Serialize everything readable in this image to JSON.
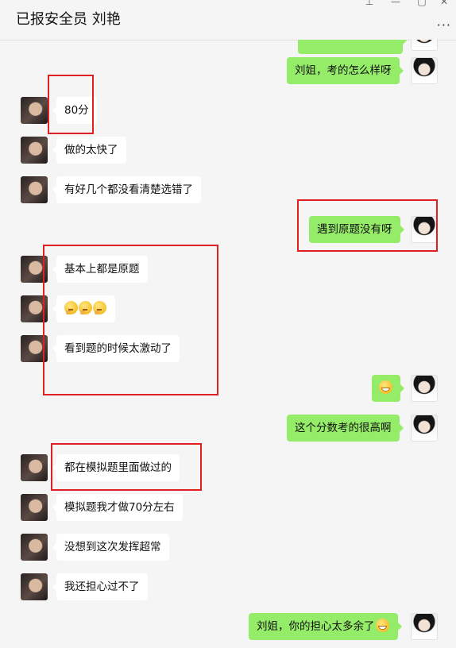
{
  "header": {
    "title": "已报安全员    刘艳",
    "pin_icon": "pin-icon",
    "minimize_icon": "minimize-icon",
    "maximize_icon": "maximize-icon",
    "close_icon": "close-icon",
    "more_label": "···"
  },
  "messages": [
    {
      "side": "right",
      "text": ""
    },
    {
      "side": "right",
      "text": "刘姐，考的怎么样呀"
    },
    {
      "side": "left",
      "text": "80分"
    },
    {
      "side": "left",
      "text": "做的太快了"
    },
    {
      "side": "left",
      "text": "有好几个都没看清楚选错了"
    },
    {
      "side": "right",
      "text": "遇到原题没有呀"
    },
    {
      "side": "left",
      "text": "基本上都是原题"
    },
    {
      "side": "left",
      "text": "",
      "emojis": [
        "thinking-emoji",
        "thinking-emoji",
        "thinking-emoji"
      ]
    },
    {
      "side": "left",
      "text": "看到题的时候太激动了"
    },
    {
      "side": "right",
      "text": "",
      "emojis": [
        "grin-emoji"
      ]
    },
    {
      "side": "right",
      "text": "这个分数考的很高啊"
    },
    {
      "side": "left",
      "text": "都在模拟题里面做过的"
    },
    {
      "side": "left",
      "text": "模拟题我才做70分左右"
    },
    {
      "side": "left",
      "text": "没想到这次发挥超常"
    },
    {
      "side": "left",
      "text": "我还担心过不了"
    },
    {
      "side": "right",
      "text": "刘姐，你的担心太多余了",
      "emojis": [
        "grin-emoji"
      ]
    }
  ],
  "highlight_color": "#e02020",
  "bubble_colors": {
    "left": "#ffffff",
    "right": "#95ec69"
  }
}
